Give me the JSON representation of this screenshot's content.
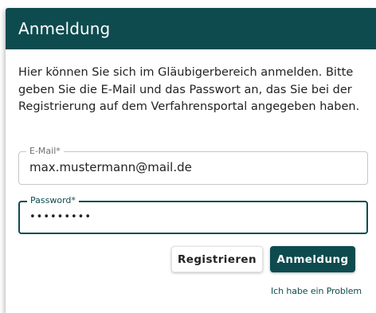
{
  "dialog": {
    "title": "Anmeldung",
    "intro_text": "Hier können Sie sich im Gläubigerbereich anmelden. Bitte geben Sie die E-Mail und das Passwort an, das Sie bei der Registrierung auf dem Verfahrensportal angegeben haben."
  },
  "form": {
    "email": {
      "label": "E-Mail*",
      "value": "max.mustermann@mail.de"
    },
    "password": {
      "label": "Password*",
      "value": "•••••••••"
    }
  },
  "actions": {
    "register_label": "Registrieren",
    "login_label": "Anmeldung",
    "problem_link": "Ich habe ein Problem"
  },
  "colors": {
    "primary": "#0e4b4f",
    "header_text": "#ffffff",
    "body_text": "#222222"
  }
}
